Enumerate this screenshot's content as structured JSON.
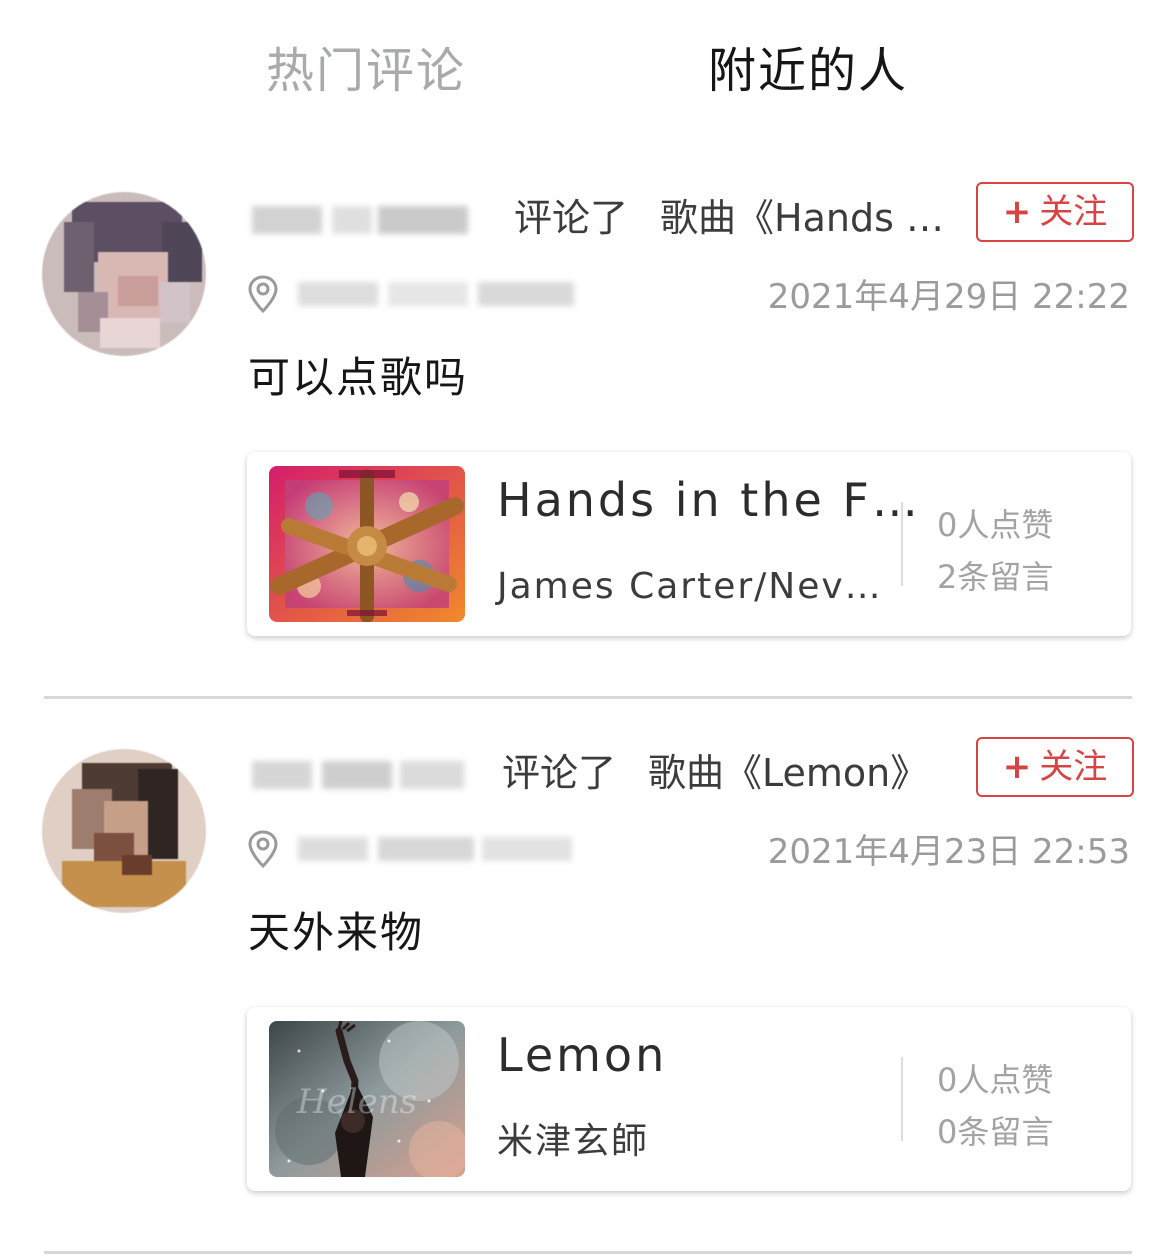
{
  "tabs": {
    "hot": "热门评论",
    "nearby": "附近的人"
  },
  "feed": [
    {
      "action": "评论了",
      "target": "歌曲《Hands …",
      "follow_label": "关注",
      "follow_plus": "+",
      "time": "2021年4月29日 22:22",
      "comment": "可以点歌吗",
      "song": {
        "title": "Hands in the F…",
        "artist": "James Carter/Nev…",
        "likes": "0人点赞",
        "messages": "2条留言",
        "cover_icon": "hands-album-cover"
      }
    },
    {
      "action": "评论了",
      "target": "歌曲《Lemon》",
      "follow_label": "关注",
      "follow_plus": "+",
      "time": "2021年4月23日 22:53",
      "comment": "天外来物",
      "song": {
        "title": "Lemon",
        "artist": "米津玄師",
        "likes": "0人点赞",
        "messages": "0条留言",
        "cover_icon": "lemon-album-cover"
      }
    }
  ],
  "colors": {
    "accent": "#d64444",
    "tab_inactive": "#a9aaab",
    "tab_active": "#161616",
    "meta": "#9b9b9b",
    "divider": "#d8d8d8"
  },
  "icons": {
    "location": "location-pin-icon",
    "follow": "plus-icon",
    "avatar": "avatar-pixelated"
  }
}
